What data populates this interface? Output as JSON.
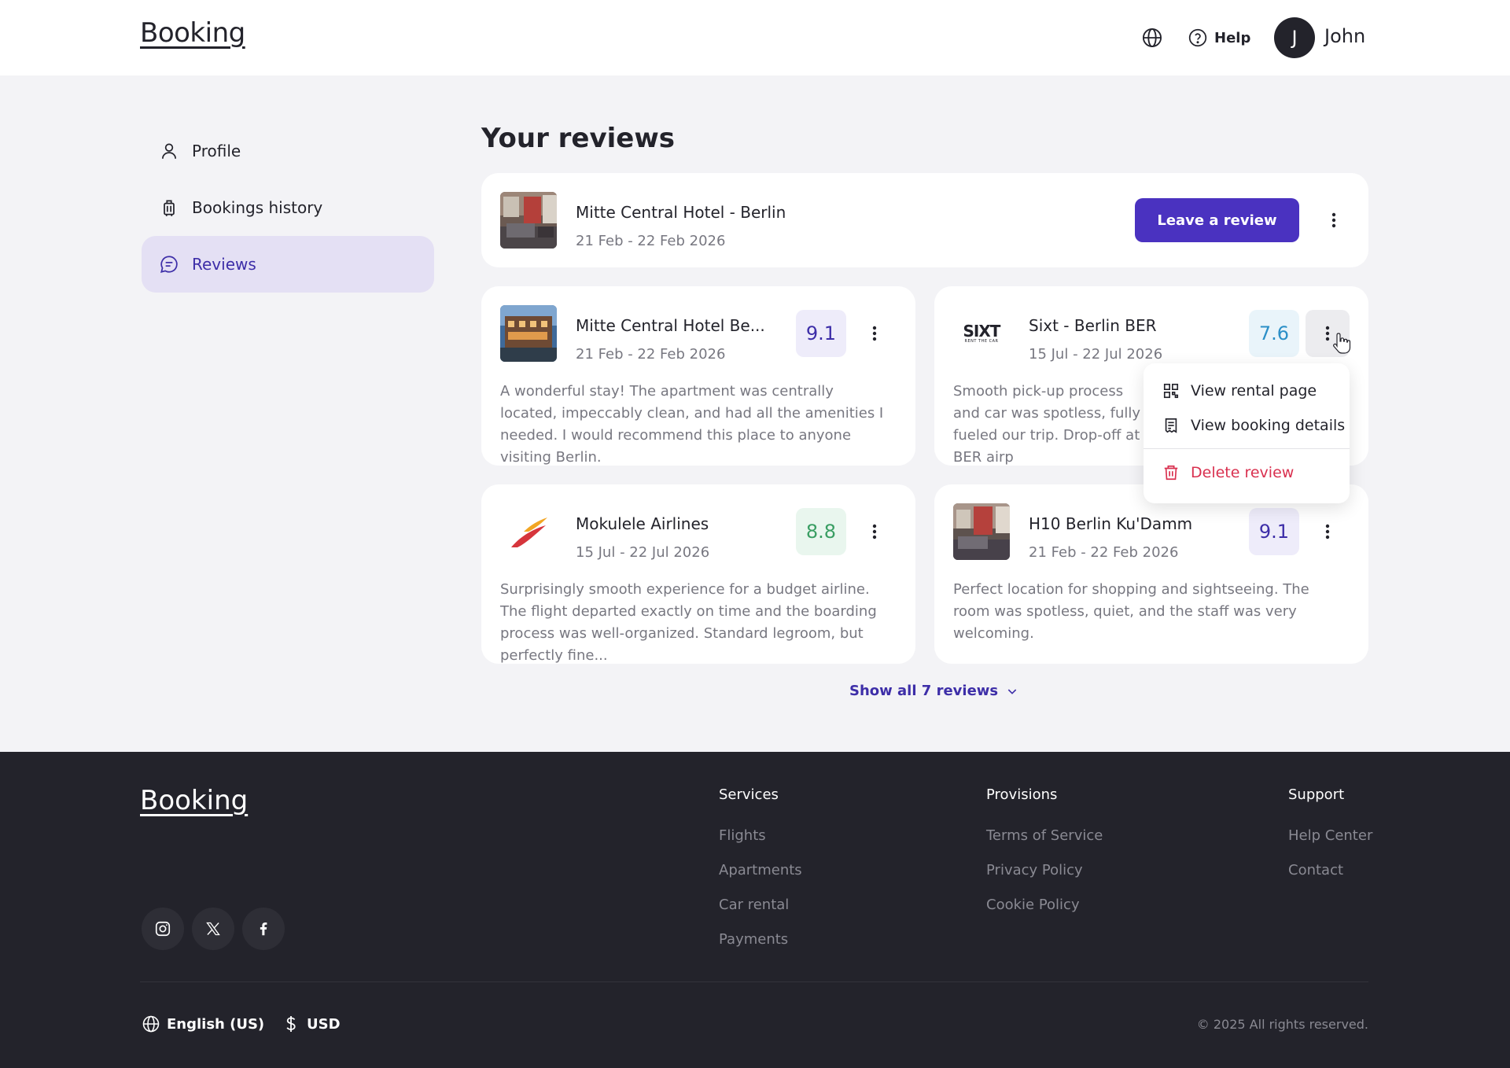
{
  "header": {
    "logo": "Booking",
    "help_label": "Help",
    "avatar_initial": "J",
    "username": "John"
  },
  "sidebar": {
    "items": [
      {
        "label": "Profile",
        "icon": "user-icon",
        "active": false
      },
      {
        "label": "Bookings history",
        "icon": "luggage-icon",
        "active": false
      },
      {
        "label": "Reviews",
        "icon": "chat-bubble-icon",
        "active": true
      }
    ]
  },
  "main": {
    "title": "Your reviews",
    "pending": {
      "title": "Mitte Central Hotel - Berlin",
      "date": "21 Feb - 22 Feb 2026",
      "button_label": "Leave a review"
    },
    "reviews": [
      {
        "title": "Mitte Central Hotel Be...",
        "date": "21 Feb - 22 Feb 2026",
        "score": "9.1",
        "score_color": "#3d2ea8",
        "score_bg": "#eeecfa",
        "text": "A wonderful stay! The apartment was centrally located, impeccably clean, and had all the amenities I needed. I would recommend this place to anyone visiting Berlin."
      },
      {
        "title": "Sixt - Berlin BER",
        "date": "15 Jul - 22 Jul 2026",
        "score": "7.6",
        "score_color": "#2b8fc7",
        "score_bg": "#e9f4fa",
        "text": "Smooth pick-up process and car was spotless, fully fueled our trip. Drop-off at BER airp",
        "logo_text": "SIXT",
        "logo_sub": "RENT THE CAR"
      },
      {
        "title": "Mokulele Airlines",
        "date": "15 Jul - 22 Jul 2026",
        "score": "8.8",
        "score_color": "#3a9e63",
        "score_bg": "#e9f6ee",
        "text": "Surprisingly smooth experience for a budget airline. The flight departed exactly on time and the boarding process was well-organized. Standard legroom, but perfectly fine..."
      },
      {
        "title": "H10 Berlin Ku'Damm",
        "date": "21 Feb - 22 Feb 2026",
        "score": "9.1",
        "score_color": "#3d2ea8",
        "score_bg": "#eeecfa",
        "text": "Perfect location for shopping and sightseeing. The room was spotless, quiet, and the staff was very welcoming."
      }
    ],
    "menu": {
      "items": [
        {
          "label": "View rental page",
          "icon": "qr-code-icon"
        },
        {
          "label": "View booking details",
          "icon": "receipt-icon"
        },
        {
          "label": "Delete review",
          "icon": "trash-icon"
        }
      ]
    },
    "show_all_label": "Show all 7 reviews"
  },
  "footer": {
    "logo": "Booking",
    "columns": [
      {
        "heading": "Services",
        "links": [
          "Flights",
          "Apartments",
          "Car rental",
          "Payments"
        ]
      },
      {
        "heading": "Provisions",
        "links": [
          "Terms of Service",
          "Privacy Policy",
          "Cookie Policy"
        ]
      },
      {
        "heading": "Support",
        "links": [
          "Help Center",
          "Contact"
        ]
      }
    ],
    "social": [
      "instagram-icon",
      "x-icon",
      "facebook-icon"
    ],
    "language": "English (US)",
    "currency": "USD",
    "copyright": "© 2025 All rights reserved."
  },
  "colors": {
    "accent": "#4a32c0",
    "accent_text": "#3d2ea8",
    "danger": "#d9304f",
    "footer_bg": "#23232b"
  }
}
